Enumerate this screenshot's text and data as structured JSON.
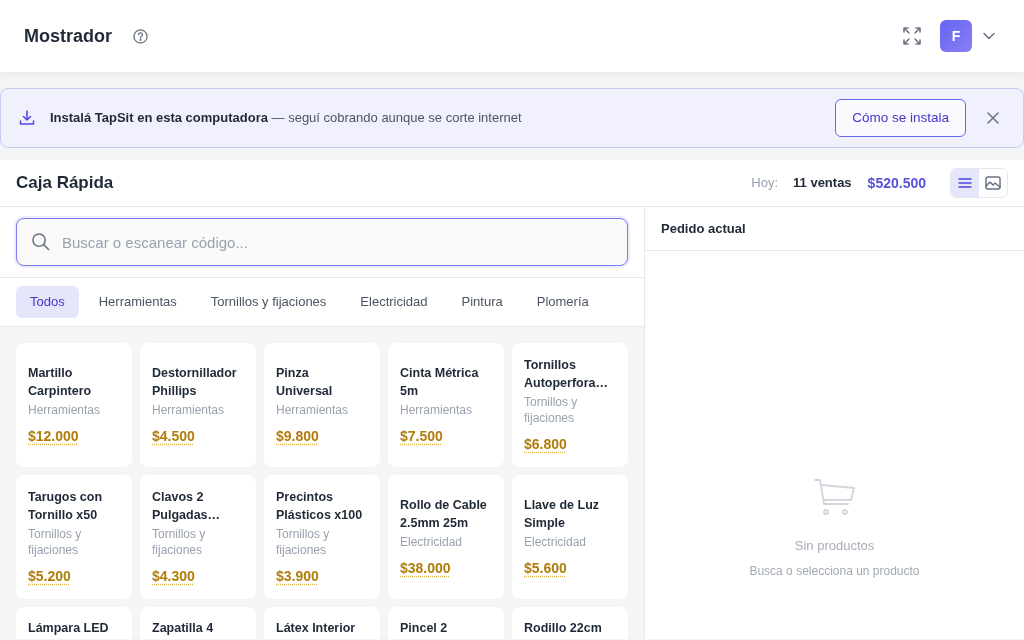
{
  "header": {
    "title": "Mostrador",
    "avatar_initial": "F"
  },
  "banner": {
    "message": "**Instalá TapSit en esta computadora** — seguí cobrando aunque se corte internet",
    "button": "Cómo se instala"
  },
  "register": {
    "title": "Caja Rápida",
    "today_label": "Hoy:",
    "sales_count": "11 ventas",
    "sales_total": "$520.500"
  },
  "view_modes": [
    {
      "kind": "list",
      "selected": true
    },
    {
      "kind": "image",
      "selected": false
    }
  ],
  "search": {
    "placeholder": "Buscar o escanear código..."
  },
  "categories": [
    {
      "label": "Todos",
      "selected": true
    },
    {
      "label": "Herramientas",
      "selected": false
    },
    {
      "label": "Tornillos y fijaciones",
      "selected": false
    },
    {
      "label": "Electricidad",
      "selected": false
    },
    {
      "label": "Pintura",
      "selected": false
    },
    {
      "label": "Plomería",
      "selected": false
    }
  ],
  "products": [
    {
      "name": "Martillo Carpintero",
      "category": "Herramientas",
      "price": "$12.000"
    },
    {
      "name": "Destornillador Phillips",
      "category": "Herramientas",
      "price": "$4.500"
    },
    {
      "name": "Pinza Universal",
      "category": "Herramientas",
      "price": "$9.800"
    },
    {
      "name": "Cinta Métrica 5m",
      "category": "Herramientas",
      "price": "$7.500"
    },
    {
      "name": "Tornillos Autoperfora…",
      "category": "Tornillos y fijaciones",
      "price": "$6.800"
    },
    {
      "name": "Tarugos con Tornillo x50",
      "category": "Tornillos y fijaciones",
      "price": "$5.200"
    },
    {
      "name": "Clavos 2 Pulgadas…",
      "category": "Tornillos y fijaciones",
      "price": "$4.300"
    },
    {
      "name": "Precintos Plásticos x100",
      "category": "Tornillos y fijaciones",
      "price": "$3.900"
    },
    {
      "name": "Rollo de Cable 2.5mm 25m",
      "category": "Electricidad",
      "price": "$38.000"
    },
    {
      "name": "Llave de Luz Simple",
      "category": "Electricidad",
      "price": "$5.600"
    },
    {
      "name": "Lámpara LED"
    },
    {
      "name": "Zapatilla 4"
    },
    {
      "name": "Látex Interior"
    },
    {
      "name": "Pincel 2"
    },
    {
      "name": "Rodillo 22cm"
    }
  ],
  "order": {
    "title": "Pedido actual",
    "empty_title": "Sin productos",
    "empty_hint": "Busca o selecciona un producto"
  }
}
